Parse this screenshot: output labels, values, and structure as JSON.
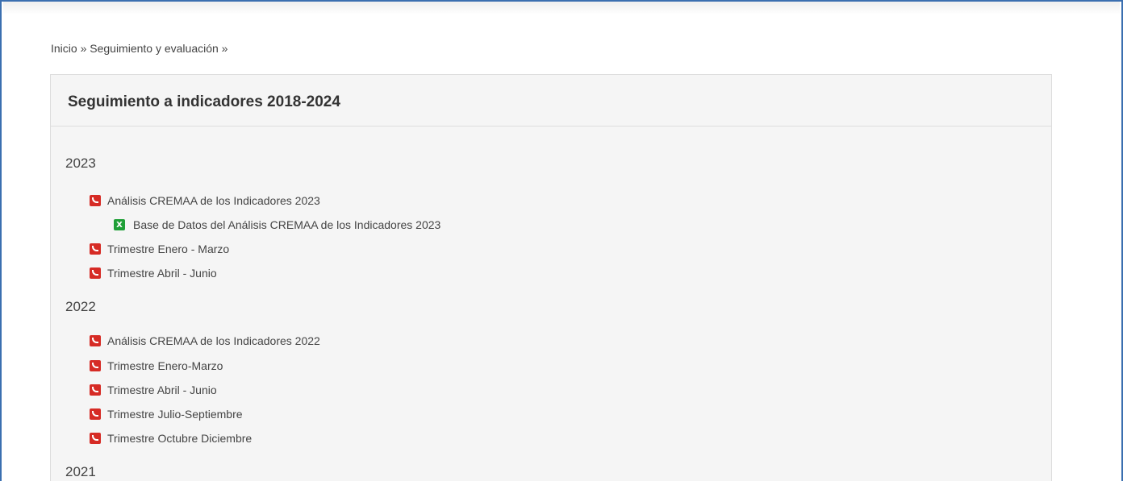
{
  "breadcrumb": "Inicio » Seguimiento y evaluación »",
  "panel": {
    "title": "Seguimiento a indicadores 2018-2024"
  },
  "sections": [
    {
      "year": "2023",
      "items": [
        {
          "label": "Análisis CREMAA de los Indicadores 2023",
          "icon": "pdf-icon"
        },
        {
          "label": "Base de Datos del Análisis CREMAA de los Indicadores 2023",
          "icon": "excel-icon",
          "excel_glyph": "X"
        },
        {
          "label": "Trimestre Enero - Marzo",
          "icon": "pdf-icon"
        },
        {
          "label": "Trimestre Abril - Junio",
          "icon": "pdf-icon"
        }
      ]
    },
    {
      "year": "2022",
      "items": [
        {
          "label": "Análisis CREMAA de los Indicadores 2022",
          "icon": "pdf-icon"
        },
        {
          "label": "Trimestre Enero-Marzo",
          "icon": "pdf-icon"
        },
        {
          "label": "Trimestre Abril - Junio",
          "icon": "pdf-icon"
        },
        {
          "label": "Trimestre Julio-Septiembre",
          "icon": "pdf-icon"
        },
        {
          "label": "Trimestre Octubre Diciembre",
          "icon": "pdf-icon"
        }
      ]
    },
    {
      "year": "2021",
      "items": []
    }
  ],
  "colors": {
    "pdf": "#d62b25",
    "excel": "#1f9f37",
    "frame_border": "#3b6fb0"
  }
}
